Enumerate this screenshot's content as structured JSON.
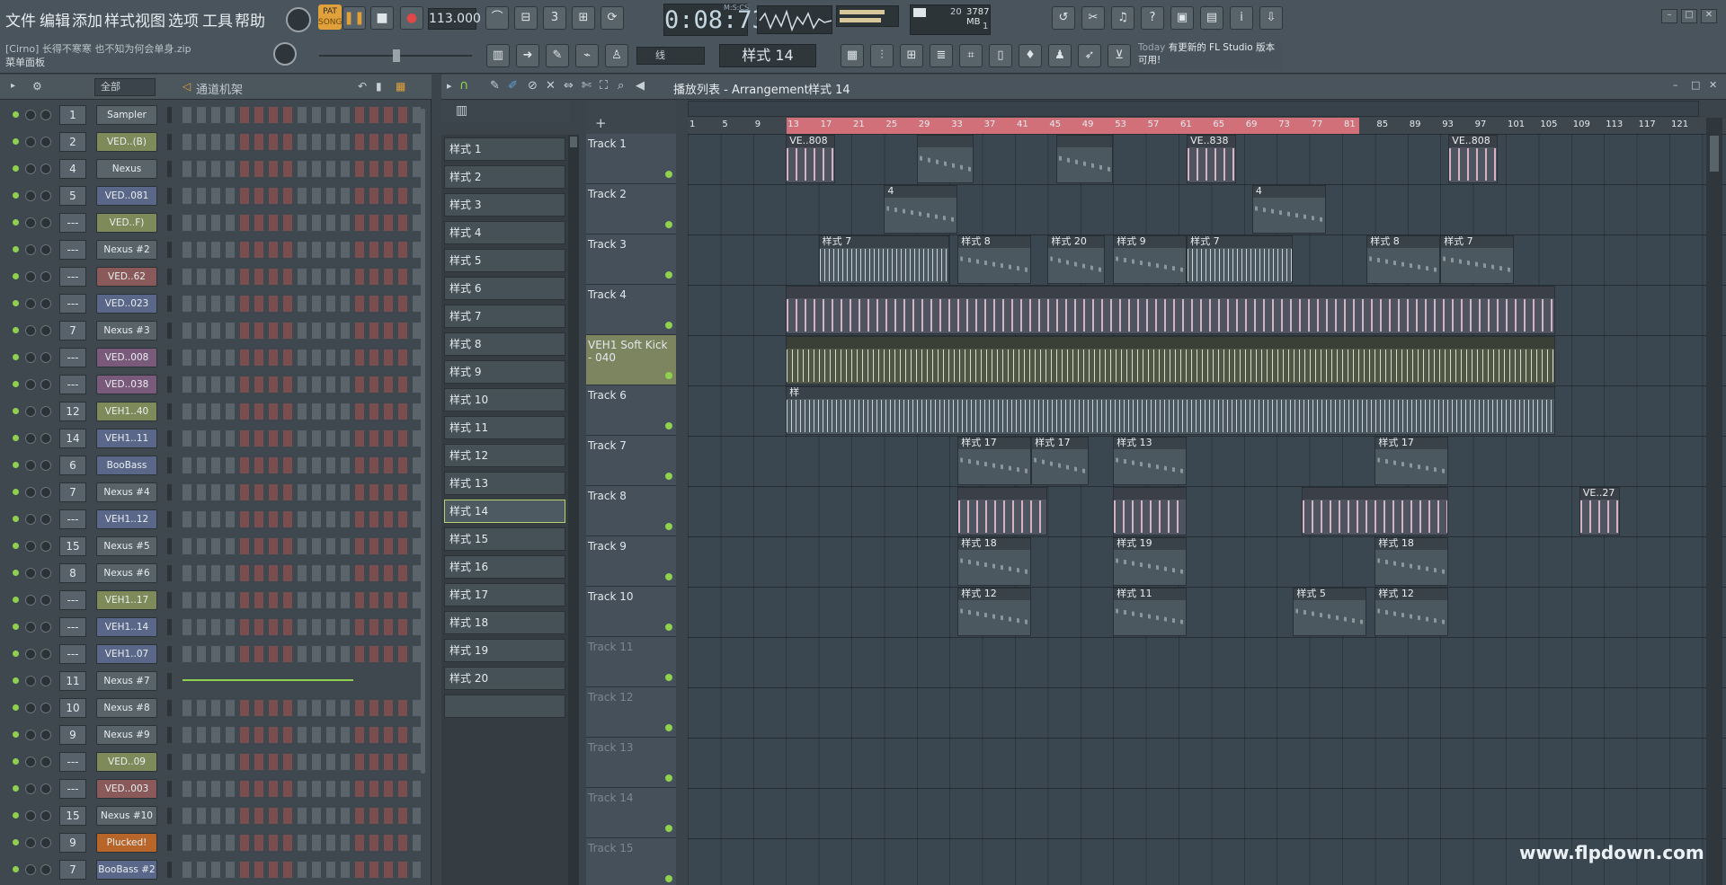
{
  "menu": [
    "文件",
    "编辑",
    "添加",
    "样式",
    "视图",
    "选项",
    "工具",
    "帮助"
  ],
  "transport": {
    "pat": "PAT",
    "song": "SONG",
    "tempo": "113.000",
    "time": "0:08:73",
    "time_label": "M:S:CS",
    "cpu": "20",
    "memory": "3787 MB",
    "poly": "1"
  },
  "file_name": "[Cirno] 长得不寒寒 也不知为何会单身.zip",
  "panel_hint": "菜单面板",
  "snap": "线",
  "current_pattern": "样式 14",
  "news": {
    "day": "Today",
    "msg": "有更新的 FL Studio 版本可用!"
  },
  "rack": {
    "filter": "全部",
    "title": "通道机架",
    "channels": [
      {
        "num": "1",
        "name": "Sampler",
        "color": "#59636a"
      },
      {
        "num": "2",
        "name": "VED..(B)",
        "color": "#7f8a5a"
      },
      {
        "num": "4",
        "name": "Nexus",
        "color": "#59636a"
      },
      {
        "num": "5",
        "name": "VED..081",
        "color": "#5a6788"
      },
      {
        "num": "---",
        "name": "VED..F)",
        "color": "#7f8a5a"
      },
      {
        "num": "---",
        "name": "Nexus #2",
        "color": "#59636a"
      },
      {
        "num": "---",
        "name": "VED..62",
        "color": "#8a5a5a"
      },
      {
        "num": "---",
        "name": "VED..023",
        "color": "#5a6788"
      },
      {
        "num": "7",
        "name": "Nexus #3",
        "color": "#59636a"
      },
      {
        "num": "---",
        "name": "VED..008",
        "color": "#7a5a7a"
      },
      {
        "num": "---",
        "name": "VED..038",
        "color": "#7a5a7a"
      },
      {
        "num": "12",
        "name": "VEH1..40",
        "color": "#7f8a5a"
      },
      {
        "num": "14",
        "name": "VEH1..11",
        "color": "#5a6788"
      },
      {
        "num": "6",
        "name": "BooBass",
        "color": "#5a6788"
      },
      {
        "num": "7",
        "name": "Nexus #4",
        "color": "#59636a"
      },
      {
        "num": "---",
        "name": "VEH1..12",
        "color": "#5a6788"
      },
      {
        "num": "15",
        "name": "Nexus #5",
        "color": "#59636a"
      },
      {
        "num": "8",
        "name": "Nexus #6",
        "color": "#59636a"
      },
      {
        "num": "---",
        "name": "VEH1..17",
        "color": "#7f8a5a"
      },
      {
        "num": "---",
        "name": "VEH1..14",
        "color": "#5a6788"
      },
      {
        "num": "---",
        "name": "VEH1..07",
        "color": "#5a6788"
      },
      {
        "num": "11",
        "name": "Nexus #7",
        "color": "#59636a"
      },
      {
        "num": "10",
        "name": "Nexus #8",
        "color": "#59636a"
      },
      {
        "num": "9",
        "name": "Nexus #9",
        "color": "#59636a"
      },
      {
        "num": "---",
        "name": "VED..09",
        "color": "#7f8a5a"
      },
      {
        "num": "---",
        "name": "VED..003",
        "color": "#8a5a5a"
      },
      {
        "num": "15",
        "name": "Nexus #10",
        "color": "#59636a"
      },
      {
        "num": "9",
        "name": "Plucked!",
        "color": "#b8652a"
      },
      {
        "num": "7",
        "name": "BooBass #2",
        "color": "#5a6788"
      }
    ]
  },
  "patterns": [
    "样式 1",
    "样式 2",
    "样式 3",
    "样式 4",
    "样式 5",
    "样式 6",
    "样式 7",
    "样式 8",
    "样式 9",
    "样式 10",
    "样式 11",
    "样式 12",
    "样式 13",
    "样式 14",
    "样式 15",
    "样式 16",
    "样式 17",
    "样式 18",
    "样式 19",
    "样式 20",
    ""
  ],
  "playlist": {
    "title": "播放列表 - Arrangement",
    "pattern": "样式 14",
    "ruler": [
      "1",
      "5",
      "9",
      "13",
      "17",
      "21",
      "25",
      "29",
      "33",
      "37",
      "41",
      "45",
      "49",
      "53",
      "57",
      "61",
      "65",
      "69",
      "73",
      "77",
      "81",
      "85",
      "89",
      "93",
      "97",
      "101",
      "105",
      "109",
      "113",
      "117",
      "121"
    ],
    "tracks": [
      "Track 1",
      "Track 2",
      "Track 3",
      "Track 4",
      "VEH1 Soft Kick - 040",
      "Track 6",
      "Track 7",
      "Track 8",
      "Track 9",
      "Track 10",
      "Track 11",
      "Track 12",
      "Track 13",
      "Track 14",
      "Track 15"
    ],
    "clips": [
      {
        "row": 0,
        "bar": 13,
        "len": 6,
        "label": "VE..808",
        "kind": "pink"
      },
      {
        "row": 0,
        "bar": 29,
        "len": 7,
        "label": "",
        "kind": "notes"
      },
      {
        "row": 0,
        "bar": 46,
        "len": 7,
        "label": "",
        "kind": "notes"
      },
      {
        "row": 0,
        "bar": 62,
        "len": 6,
        "label": "VE..838",
        "kind": "pink"
      },
      {
        "row": 0,
        "bar": 94,
        "len": 6,
        "label": "VE..808",
        "kind": "pink"
      },
      {
        "row": 1,
        "bar": 25,
        "len": 9,
        "label": "4",
        "kind": "notes"
      },
      {
        "row": 1,
        "bar": 70,
        "len": 9,
        "label": "4",
        "kind": "notes"
      },
      {
        "row": 2,
        "bar": 17,
        "len": 16,
        "label": "样式 7",
        "kind": "wave"
      },
      {
        "row": 2,
        "bar": 34,
        "len": 9,
        "label": "样式 8",
        "kind": "notes"
      },
      {
        "row": 2,
        "bar": 45,
        "len": 7,
        "label": "样式 20",
        "kind": "notes"
      },
      {
        "row": 2,
        "bar": 53,
        "len": 9,
        "label": "样式 9",
        "kind": "notes"
      },
      {
        "row": 2,
        "bar": 62,
        "len": 13,
        "label": "样式 7",
        "kind": "wave"
      },
      {
        "row": 2,
        "bar": 84,
        "len": 9,
        "label": "样式 8",
        "kind": "notes"
      },
      {
        "row": 2,
        "bar": 93,
        "len": 9,
        "label": "样式 7",
        "kind": "notes"
      },
      {
        "row": 3,
        "bar": 13,
        "len": 94,
        "label": "",
        "kind": "pink"
      },
      {
        "row": 4,
        "bar": 13,
        "len": 94,
        "label": "",
        "kind": "yellow"
      },
      {
        "row": 5,
        "bar": 13,
        "len": 94,
        "label": "样",
        "kind": "wave"
      },
      {
        "row": 6,
        "bar": 34,
        "len": 9,
        "label": "样式 17",
        "kind": "notes"
      },
      {
        "row": 6,
        "bar": 43,
        "len": 7,
        "label": "样式 17",
        "kind": "notes"
      },
      {
        "row": 6,
        "bar": 53,
        "len": 9,
        "label": "样式 13",
        "kind": "notes"
      },
      {
        "row": 6,
        "bar": 85,
        "len": 9,
        "label": "样式 17",
        "kind": "notes"
      },
      {
        "row": 7,
        "bar": 34,
        "len": 11,
        "label": "",
        "kind": "pink"
      },
      {
        "row": 7,
        "bar": 53,
        "len": 9,
        "label": "",
        "kind": "pink"
      },
      {
        "row": 7,
        "bar": 76,
        "len": 18,
        "label": "",
        "kind": "pink"
      },
      {
        "row": 7,
        "bar": 110,
        "len": 5,
        "label": "VE..27",
        "kind": "pink"
      },
      {
        "row": 8,
        "bar": 34,
        "len": 9,
        "label": "样式 18",
        "kind": "notes"
      },
      {
        "row": 8,
        "bar": 53,
        "len": 9,
        "label": "样式 19",
        "kind": "notes"
      },
      {
        "row": 8,
        "bar": 85,
        "len": 9,
        "label": "样式 18",
        "kind": "notes"
      },
      {
        "row": 9,
        "bar": 34,
        "len": 9,
        "label": "样式 12",
        "kind": "notes"
      },
      {
        "row": 9,
        "bar": 53,
        "len": 9,
        "label": "样式 11",
        "kind": "notes"
      },
      {
        "row": 9,
        "bar": 75,
        "len": 9,
        "label": "样式 5",
        "kind": "notes"
      },
      {
        "row": 9,
        "bar": 85,
        "len": 9,
        "label": "样式 12",
        "kind": "notes"
      }
    ]
  },
  "watermark": "www.flpdown.com"
}
